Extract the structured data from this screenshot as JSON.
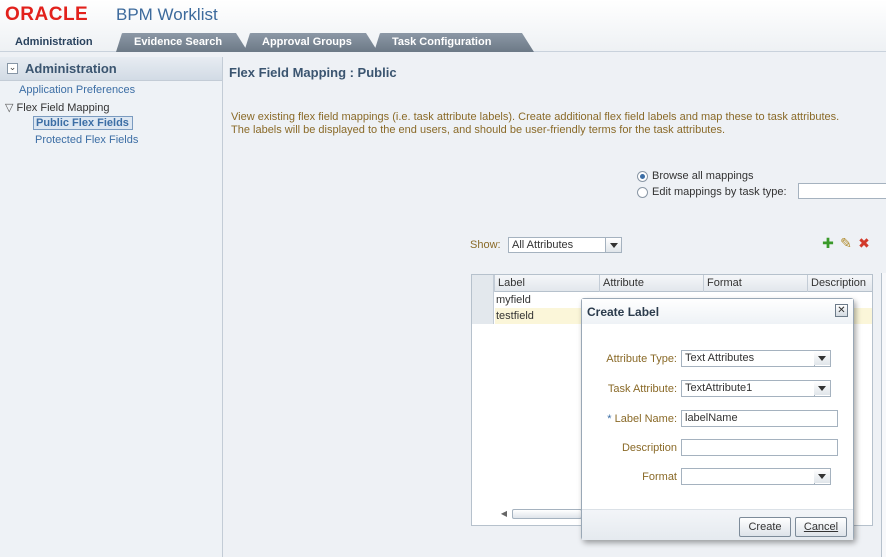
{
  "header": {
    "logo": "ORACLE",
    "app_title": "BPM Worklist"
  },
  "tabs": [
    {
      "label": "Administration",
      "active": true
    },
    {
      "label": "Evidence Search",
      "active": false
    },
    {
      "label": "Approval Groups",
      "active": false
    },
    {
      "label": "Task Configuration",
      "active": false
    }
  ],
  "sidebar": {
    "title": "Administration",
    "items": [
      {
        "label": "Application Preferences"
      },
      {
        "label": "Flex Field Mapping"
      },
      {
        "label": "Public Flex Fields",
        "selected": true
      },
      {
        "label": "Protected Flex Fields"
      }
    ]
  },
  "main": {
    "title": "Flex Field Mapping : Public",
    "description_line1": "View existing flex field mappings (i.e. task attribute labels). Create additional flex field labels and map these to task attributes.",
    "description_line2": "The labels will be displayed to the end users, and should be user-friendly terms for the task attributes.",
    "radio_browse": "Browse all mappings",
    "radio_edit": "Edit mappings by task type:",
    "show_label": "Show:",
    "show_value": "All Attributes",
    "table": {
      "columns": [
        "Label",
        "Attribute",
        "Format",
        "Description"
      ],
      "rows": [
        {
          "label": "myfield"
        },
        {
          "label": "testfield"
        }
      ]
    }
  },
  "dialog": {
    "title": "Create Label",
    "attribute_type_label": "Attribute Type:",
    "attribute_type_value": "Text Attributes",
    "task_attribute_label": "Task Attribute:",
    "task_attribute_value": "TextAttribute1",
    "label_name_required": "*",
    "label_name_label": "Label Name:",
    "label_name_value": "labelName",
    "description_label": "Description",
    "description_value": "",
    "format_label": "Format",
    "format_value": "",
    "create_button": "Create",
    "cancel_button": "Cancel"
  },
  "colors": {
    "oracle_red": "#e2211c",
    "title_blue": "#3b5570",
    "link_blue": "#3c6ea5",
    "label_brown": "#8a6a28"
  }
}
